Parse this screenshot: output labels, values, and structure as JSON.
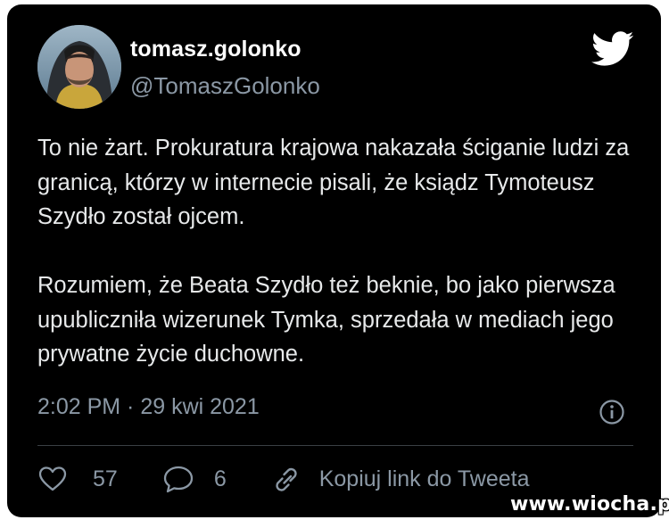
{
  "tweet": {
    "author": {
      "display_name": "tomasz.golonko",
      "handle": "@TomaszGolonko",
      "avatar": "profile-photo"
    },
    "paragraphs": [
      "To nie żart. Prokuratura krajowa nakazała ściganie ludzi za granicą, którzy w internecie pisali, że ksiądz Tymoteusz Szydło został ojcem.",
      "Rozumiem, że Beata Szydło też beknie, bo jako pierwsza upubliczniła wizerunek Tymka, sprzedała w mediach jego prywatne życie duchowne."
    ],
    "timestamp": "2:02 PM · 29 kwi 2021",
    "actions": {
      "like_count": "57",
      "reply_count": "6",
      "copy_link_label": "Kopiuj link do Tweeta"
    }
  },
  "icons": {
    "brand": "twitter-bird-icon",
    "info": "info-icon",
    "like": "heart-icon",
    "reply": "speech-bubble-icon",
    "copy": "link-icon"
  },
  "colors": {
    "background": "#000000",
    "primary_text": "#e7e9ea",
    "secondary_text": "#8b98a5",
    "divider": "#3a3f44"
  },
  "watermark": "www.wiocha.pl"
}
